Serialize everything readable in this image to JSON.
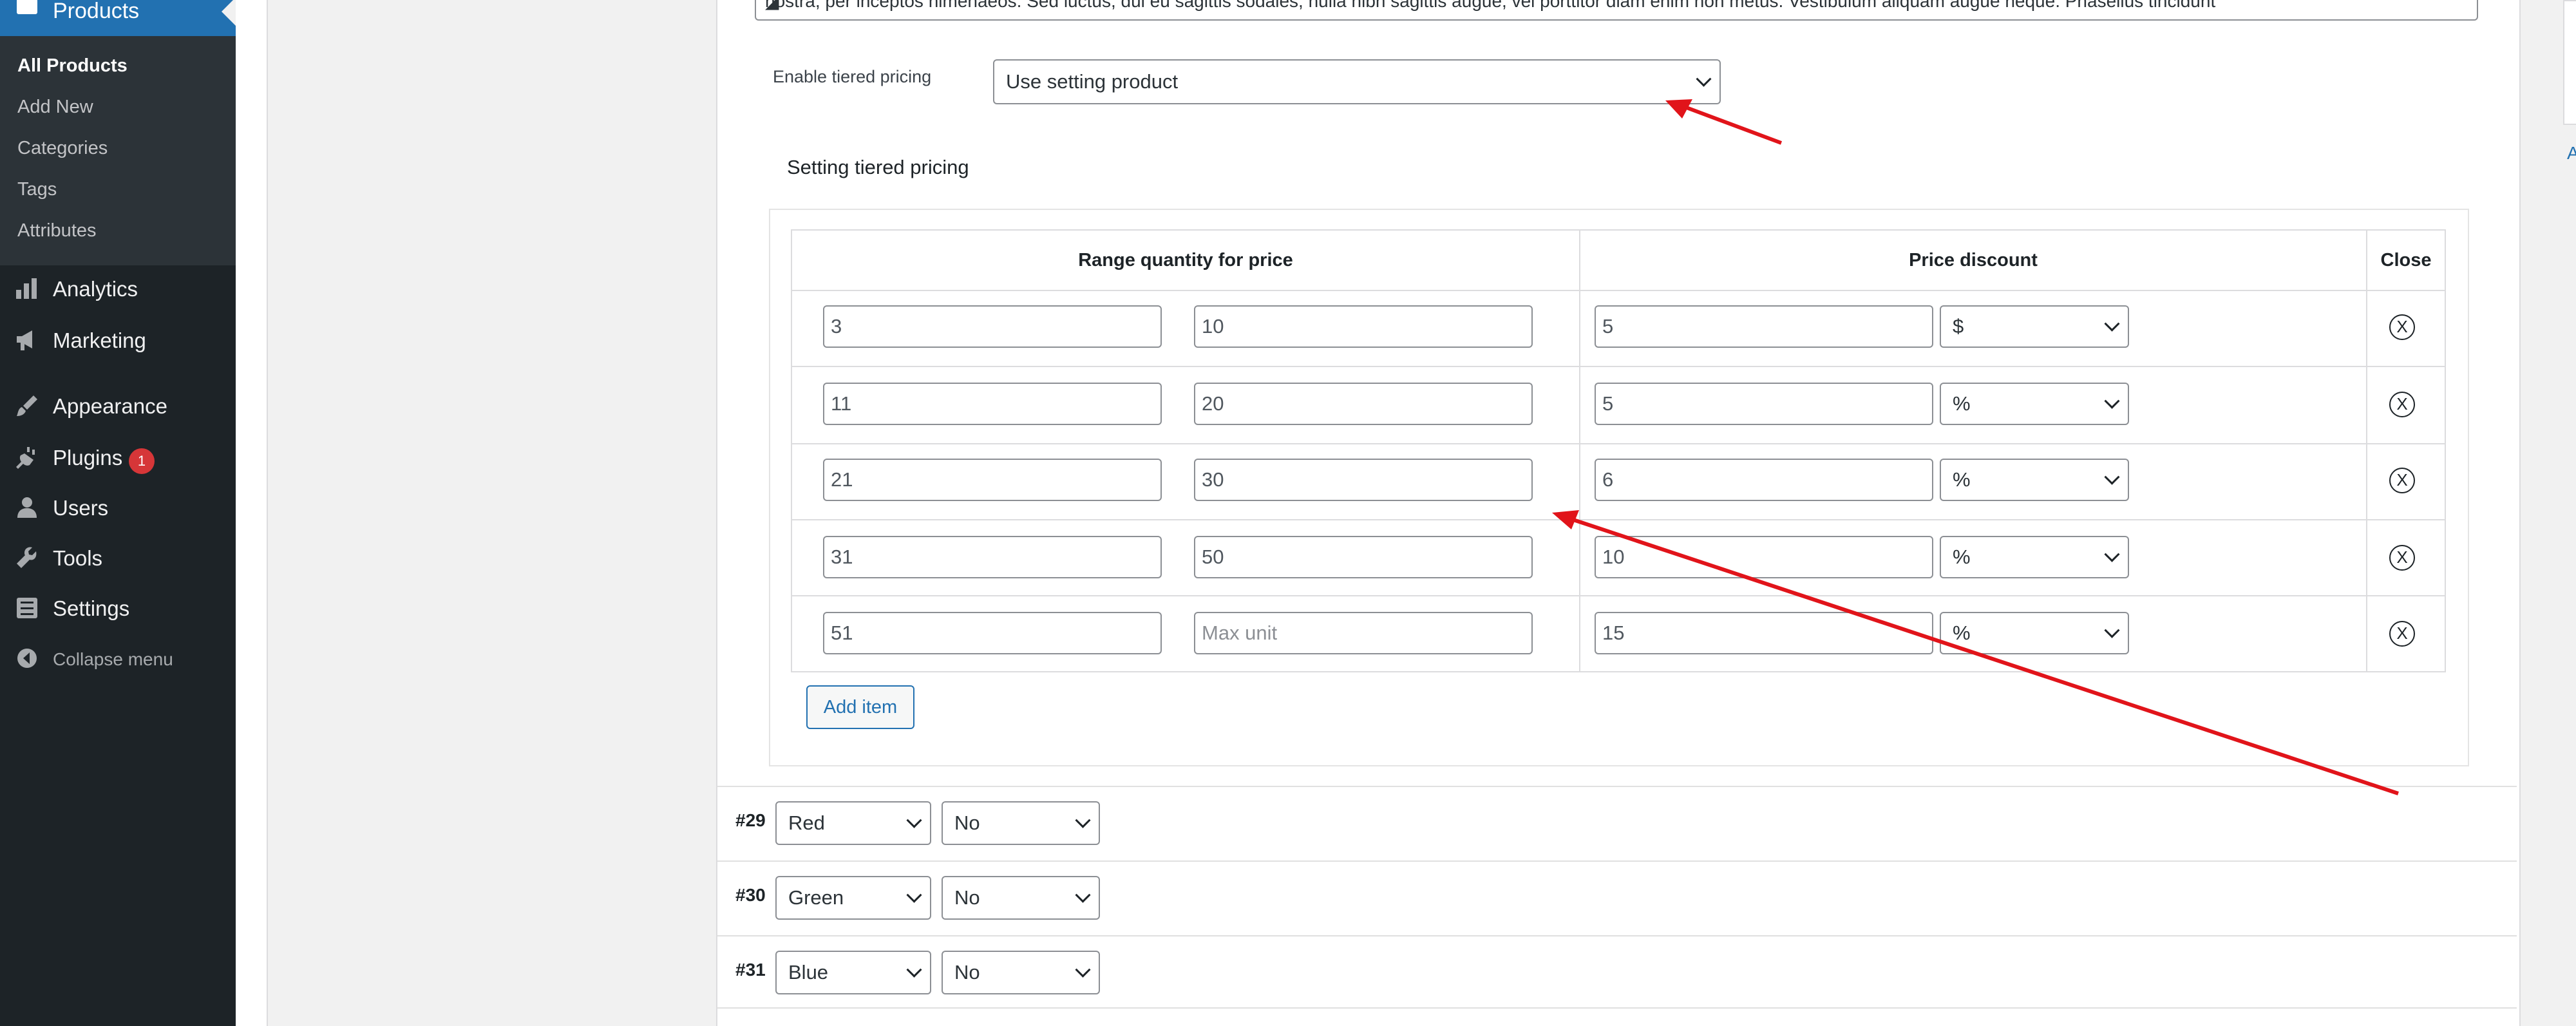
{
  "sidebar": {
    "products_label": "Products",
    "submenu": [
      "All Products",
      "Add New",
      "Categories",
      "Tags",
      "Attributes"
    ],
    "menu": {
      "analytics": "Analytics",
      "marketing": "Marketing",
      "appearance": "Appearance",
      "plugins": "Plugins",
      "plugins_badge": "1",
      "users": "Users",
      "tools": "Tools",
      "settings": "Settings",
      "collapse": "Collapse menu"
    }
  },
  "description_text": "nostra, per inceptos himenaeos. Sed luctus, dui eu sagittis sodales, nulla nibh sagittis augue, vel porttitor diam enim non metus. Vestibulum aliquam augue neque. Phasellus tincidunt",
  "tiered_pricing": {
    "enable_label": "Enable tiered pricing",
    "enable_value": "Use setting product",
    "setting_label": "Setting tiered pricing",
    "col_range": "Range quantity for price",
    "col_discount": "Price discount",
    "col_close": "Close",
    "max_placeholder": "Max unit",
    "rows": [
      {
        "min": "3",
        "max": "10",
        "discount": "5",
        "unit": "$"
      },
      {
        "min": "11",
        "max": "20",
        "discount": "5",
        "unit": "%"
      },
      {
        "min": "21",
        "max": "30",
        "discount": "6",
        "unit": "%"
      },
      {
        "min": "31",
        "max": "50",
        "discount": "10",
        "unit": "%"
      },
      {
        "min": "51",
        "max": "",
        "discount": "15",
        "unit": "%"
      }
    ],
    "add_item": "Add item"
  },
  "variations": [
    {
      "id": "#29",
      "color": "Red",
      "option": "No"
    },
    {
      "id": "#30",
      "color": "Green",
      "option": "No"
    },
    {
      "id": "#31",
      "color": "Blue",
      "option": "No"
    }
  ],
  "annotation_color": "#e1141a",
  "accent_color": "#2271b1"
}
